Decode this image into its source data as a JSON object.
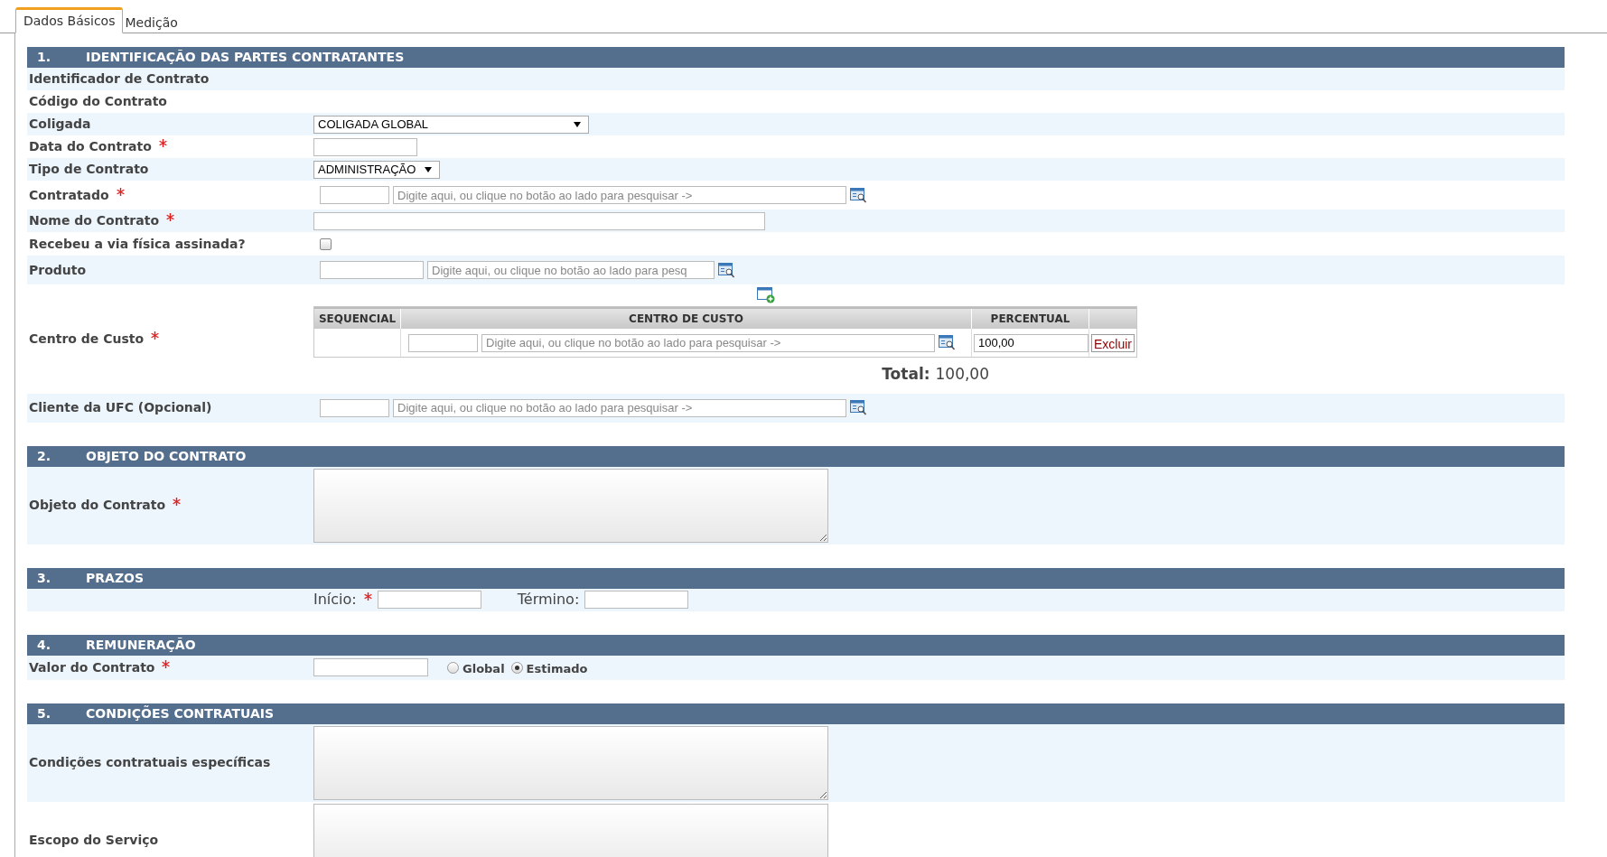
{
  "tabs": [
    {
      "label": "Dados Básicos",
      "selected": true
    },
    {
      "label": "Medição",
      "selected": false
    }
  ],
  "sections": [
    {
      "number": "1.",
      "title": "IDENTIFICAÇÃO DAS PARTES CONTRATANTES",
      "rows": [
        {
          "kind": "empty",
          "label": "Identificador de Contrato",
          "required": false
        },
        {
          "kind": "empty",
          "label": "Código do Contrato",
          "required": false
        },
        {
          "kind": "long_select",
          "label": "Coligada",
          "required": false,
          "value": "COLIGADA GLOBAL"
        },
        {
          "kind": "date",
          "label": "Data do Contrato",
          "required": true
        },
        {
          "kind": "select",
          "label": "Tipo de Contrato",
          "required": false,
          "value": "ADMINISTRAÇÃO"
        },
        {
          "kind": "lookup",
          "label": "Contratado",
          "required": true,
          "placeholder": "Digite aqui, ou clique no botão ao lado para pesquisar ->"
        },
        {
          "kind": "text",
          "label": "Nome do Contrato",
          "required": true
        },
        {
          "kind": "checkbox",
          "label": "Recebeu a via física assinada?",
          "required": false,
          "checked": false
        },
        {
          "kind": "short_lookup",
          "label": "Produto",
          "required": false,
          "placeholder": "Digite aqui, ou clique no botão ao lado para pesq"
        },
        {
          "kind": "cost_center",
          "label": "Centro de Custo",
          "required": true,
          "columns": [
            "SEQUENCIAL",
            "CENTRO DE CUSTO",
            "PERCENTUAL"
          ],
          "entries": [
            {
              "placeholder": "Digite aqui, ou clique no botão ao lado para pesquisar ->",
              "percentual": "100,00",
              "action": "Excluir"
            }
          ],
          "total_label": "Total:",
          "total_value": "100,00"
        },
        {
          "kind": "lookup",
          "label": "Cliente da UFC (Opcional)",
          "required": false,
          "placeholder": "Digite aqui, ou clique no botão ao lado para pesquisar ->"
        }
      ]
    },
    {
      "number": "2.",
      "title": "OBJETO DO CONTRATO",
      "rows": [
        {
          "kind": "textarea",
          "label": "Objeto do Contrato",
          "required": true
        }
      ]
    },
    {
      "number": "3.",
      "title": "PRAZOS",
      "rows": [
        {
          "kind": "dates",
          "fields": [
            {
              "label": "Início:",
              "required": true
            },
            {
              "label": "Término:",
              "required": false
            }
          ]
        }
      ]
    },
    {
      "number": "4.",
      "title": "REMUNERAÇÃO",
      "rows": [
        {
          "kind": "value_radio",
          "label": "Valor do Contrato",
          "required": true,
          "options": [
            {
              "label": "Global",
              "selected": false
            },
            {
              "label": "Estimado",
              "selected": true
            }
          ]
        }
      ]
    },
    {
      "number": "5.",
      "title": "CONDIÇÕES CONTRATUAIS",
      "rows": [
        {
          "kind": "textarea",
          "label": "Condições contratuais específicas",
          "required": false
        },
        {
          "kind": "textarea",
          "label": "Escopo do Serviço",
          "required": false
        }
      ]
    }
  ]
}
